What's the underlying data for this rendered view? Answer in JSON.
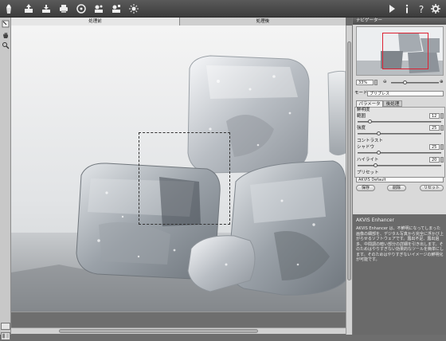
{
  "toolbar": {
    "icons": [
      "app-logo-icon",
      "open-icon",
      "save-icon",
      "print-icon",
      "share-icon",
      "batch-icon",
      "plugin-icon",
      "settings-sun-icon",
      "run-icon",
      "info-icon",
      "help-icon",
      "preferences-icon"
    ]
  },
  "tabs": {
    "before": "処理前",
    "after": "処理後"
  },
  "navigator": {
    "title": "ナビゲーター",
    "zoom": "33%"
  },
  "mode": {
    "label": "モード:",
    "value": "プリプレス"
  },
  "params": {
    "tab_params": "パラメーター",
    "tab_post": "後処理",
    "sharpness_header": "鮮明度",
    "range_label": "範囲",
    "range_value": "12",
    "strength_label": "強度",
    "strength_value": "25",
    "contrast_header": "コントラスト",
    "shadow_label": "シャドウ",
    "shadow_value": "25",
    "highlight_label": "ハイライト",
    "highlight_value": "20"
  },
  "presets": {
    "label": "プリセット",
    "value": "AKVIS Default",
    "save": "保存",
    "delete": "削除",
    "reset": "リセット"
  },
  "help": {
    "title": "AKVIS Enhancer",
    "text": "AKVIS Enhancer は、不鮮明になってしまった画像の細部を、デジタル写真から完全に浮かび上がらせるソフトウェアです。露出不足、露出過多、中間調の暗い部分の詳細を引き出します。そのためはやりすぎない効果的なツールを簡単にします。そのためはやりすぎないイメージの鮮明化が可能です。"
  }
}
